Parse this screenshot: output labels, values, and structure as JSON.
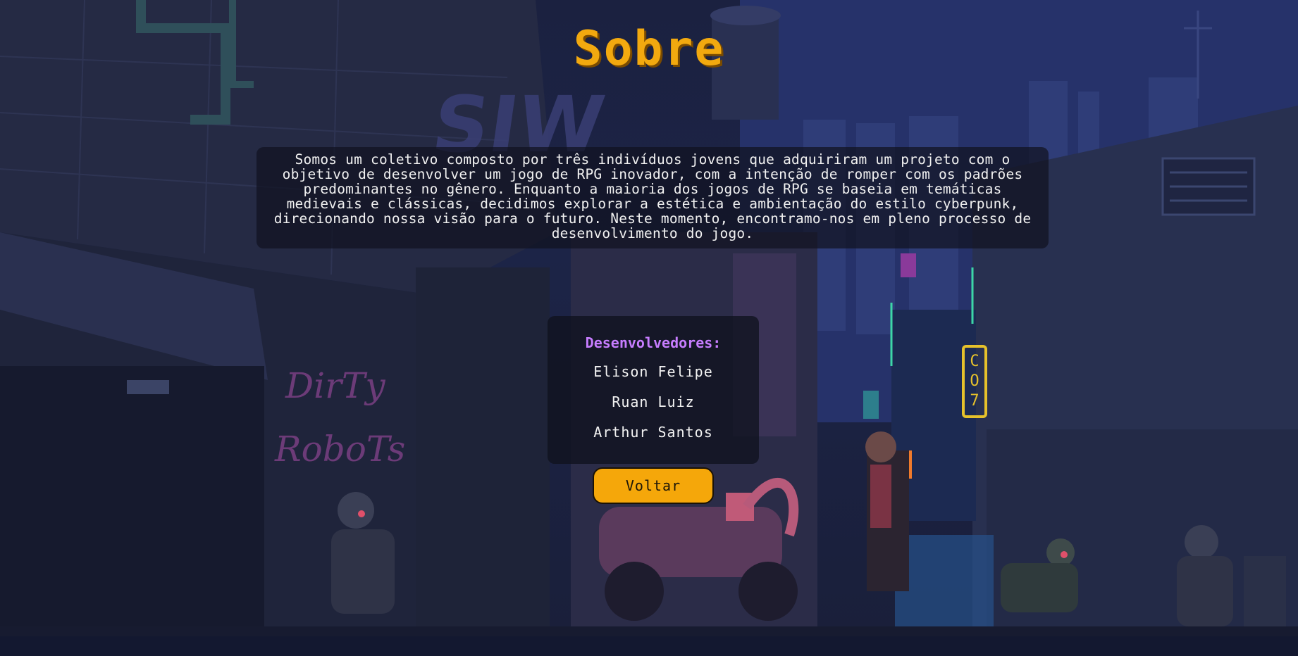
{
  "page": {
    "title": "Sobre",
    "description": "Somos um coletivo composto por três indivíduos jovens que adquiriram um projeto com o objetivo de desenvolver um jogo de RPG inovador, com a intenção de romper com os padrões predominantes no gênero. Enquanto a maioria dos jogos de RPG se baseia em temáticas medievais e clássicas, decidimos explorar a estética e ambientação do estilo cyberpunk, direcionando nossa visão para o futuro. Neste momento, encontramo-nos em pleno processo de desenvolvimento do jogo."
  },
  "developers": {
    "heading": "Desenvolvedores:",
    "names": [
      "Elison Felipe",
      "Ruan Luiz",
      "Arthur Santos"
    ]
  },
  "back_button": {
    "label": "Voltar"
  },
  "background": {
    "graffiti_top": "SIW",
    "graffiti_wall": [
      "DirTy",
      "RoboTs"
    ],
    "neon_sign": [
      "C",
      "O",
      "7"
    ]
  },
  "colors": {
    "title": "#f2a90f",
    "heading": "#c77dff",
    "button": "#f5a70a",
    "panel": "#10121e"
  }
}
